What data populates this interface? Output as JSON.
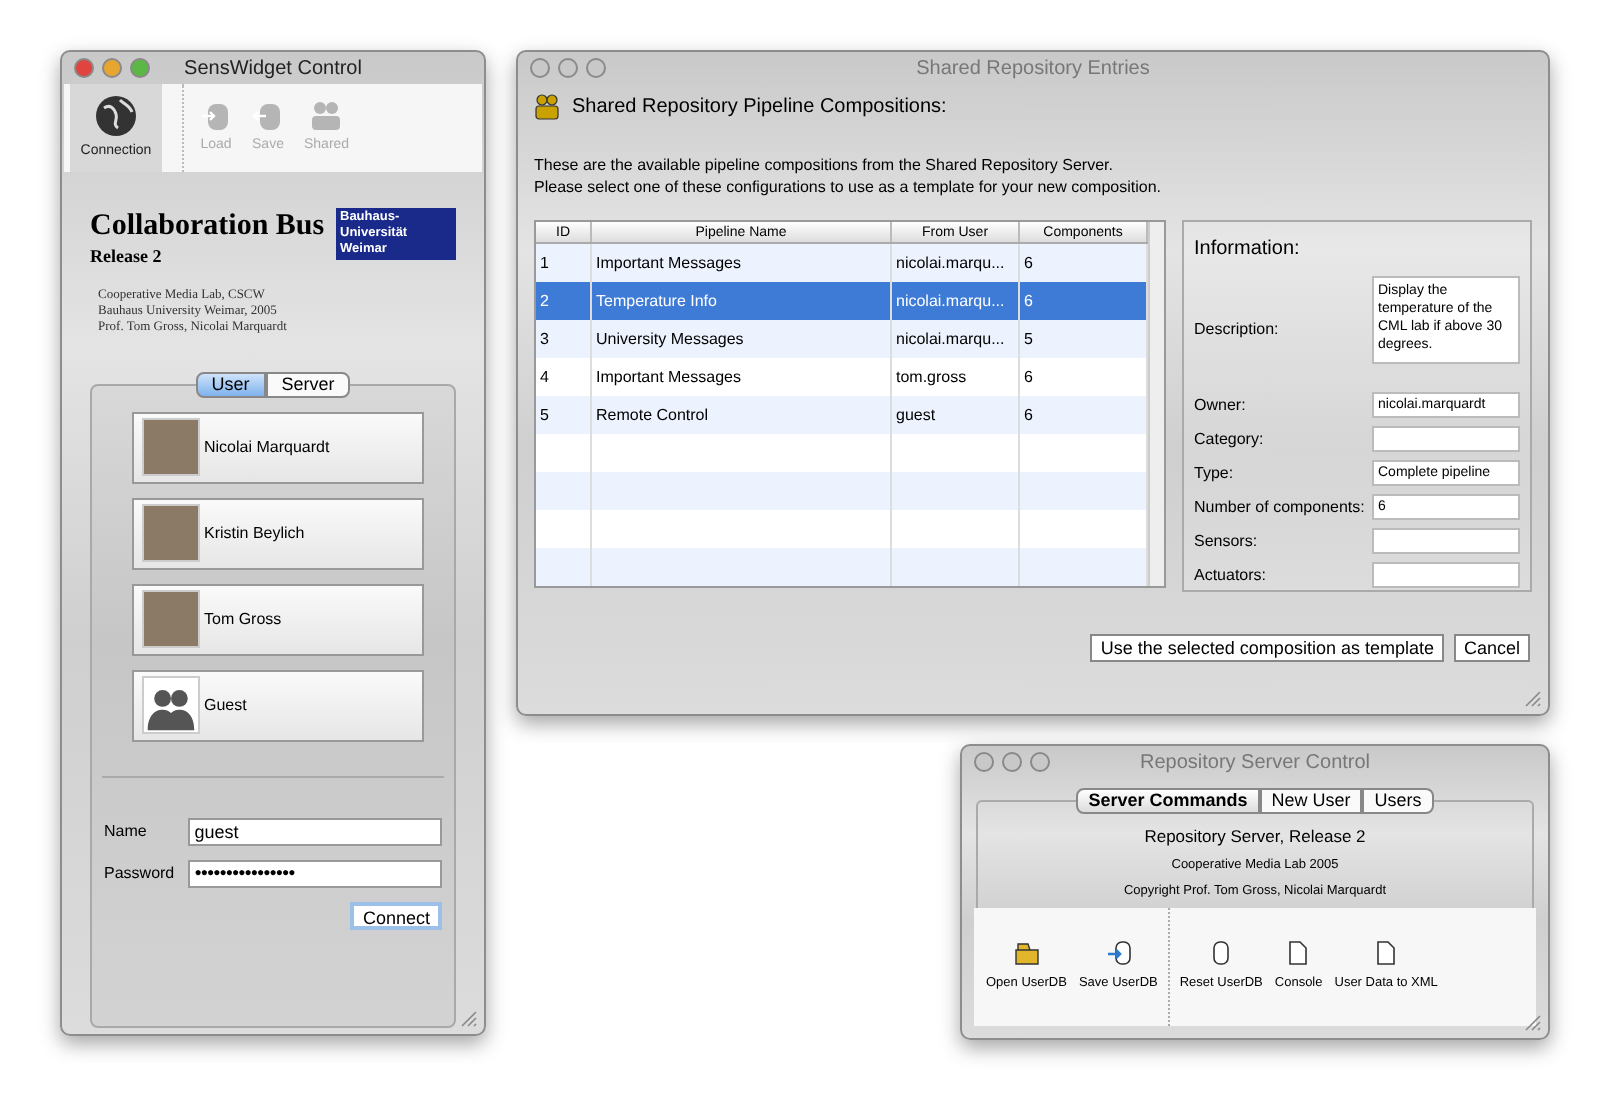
{
  "connection_window": {
    "title": "SensWidget Control",
    "active": true,
    "toolbar": [
      {
        "label": "Connection",
        "selected": true,
        "disabled": false
      },
      {
        "label": "Load",
        "selected": false,
        "disabled": true
      },
      {
        "label": "Save",
        "selected": false,
        "disabled": true
      },
      {
        "label": "Shared",
        "selected": false,
        "disabled": true
      }
    ],
    "product": "Collaboration Bus",
    "release": "Release 2",
    "badge": "Bauhaus-Universität Weimar",
    "credits": [
      "Cooperative Media Lab, CSCW",
      "Bauhaus University Weimar, 2005",
      "Prof. Tom Gross, Nicolai Marquardt"
    ],
    "tabs": [
      {
        "label": "User",
        "selected": true
      },
      {
        "label": "Server",
        "selected": false
      }
    ],
    "users": [
      {
        "name": "Nicolai Marquardt",
        "kind": "photo"
      },
      {
        "name": "Kristin Beylich",
        "kind": "photo"
      },
      {
        "name": "Tom Gross",
        "kind": "photo"
      },
      {
        "name": "Guest",
        "kind": "guest"
      }
    ],
    "fields": [
      {
        "label": "Name",
        "value": "guest",
        "kind": "text"
      },
      {
        "label": "Password",
        "value": "●●●●●●●●●●●●●●●●",
        "kind": "password"
      }
    ],
    "connect_button": "Connect"
  },
  "entries_window": {
    "title": "Shared Repository Entries",
    "active": false,
    "heading": "Shared Repository Pipeline Compositions:",
    "intro": [
      "These are the available pipeline compositions from the Shared Repository Server.",
      "Please select one of these configurations to use as a template for your new composition."
    ],
    "table": {
      "columns": [
        "ID",
        "Pipeline Name",
        "From User",
        "Components"
      ],
      "rows": [
        {
          "cells": [
            "1",
            "Important Messages",
            "nicolai.marqu...",
            "6"
          ],
          "selected": false
        },
        {
          "cells": [
            "2",
            "Temperature Info",
            "nicolai.marqu...",
            "6"
          ],
          "selected": true
        },
        {
          "cells": [
            "3",
            "University Messages",
            "nicolai.marqu...",
            "5"
          ],
          "selected": false
        },
        {
          "cells": [
            "4",
            "Important Messages",
            "tom.gross",
            "6"
          ],
          "selected": false
        },
        {
          "cells": [
            "5",
            "Remote Control",
            "guest",
            "6"
          ],
          "selected": false
        }
      ]
    },
    "info": {
      "title": "Information:",
      "fields": [
        {
          "label": "Description:",
          "value": "Display the temperature of the CML lab if above 30 degrees.",
          "kind": "multiline"
        },
        {
          "label": "Owner:",
          "value": "nicolai.marquardt",
          "kind": "text"
        },
        {
          "label": "Category:",
          "kind": "text"
        },
        {
          "label": "Type:",
          "value": "Complete pipeline",
          "kind": "text"
        },
        {
          "label": "Number of components:",
          "value": "6",
          "kind": "text"
        },
        {
          "label": "Sensors:",
          "kind": "text"
        },
        {
          "label": "Actuators:",
          "kind": "text"
        }
      ]
    },
    "buttons": [
      "Use the selected composition as template",
      "Cancel"
    ]
  },
  "server_window": {
    "title": "Repository Server Control",
    "active": false,
    "tabs": [
      {
        "label": "Server Commands",
        "selected": true
      },
      {
        "label": "New User",
        "selected": false
      },
      {
        "label": "Users",
        "selected": false
      }
    ],
    "lines": [
      "Repository Server, Release 2",
      "Cooperative Media Lab 2005",
      "Copyright Prof. Tom Gross, Nicolai Marquardt"
    ],
    "toolbar_groups": [
      [
        "Open UserDB",
        "Save UserDB"
      ],
      [
        "Reset UserDB",
        "Console",
        "User Data to XML"
      ]
    ]
  }
}
